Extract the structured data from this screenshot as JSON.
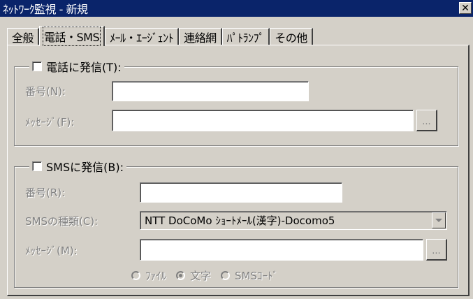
{
  "window": {
    "title": "ﾈｯﾄﾜｰｸ監視 - 新規",
    "close_glyph": "✕"
  },
  "tabs": [
    {
      "label": "全般",
      "active": false
    },
    {
      "label": "電話・SMS",
      "active": true
    },
    {
      "label": "ﾒｰﾙ・ｴｰｼﾞｪﾝﾄ",
      "active": false
    },
    {
      "label": "連絡網",
      "active": false
    },
    {
      "label": "ﾊﾟﾄﾗﾝﾌﾟ",
      "active": false
    },
    {
      "label": "その他",
      "active": false
    }
  ],
  "phone_group": {
    "checkbox_label": "電話に発信(T):",
    "checked": false,
    "number_label": "番号(N):",
    "number_value": "",
    "message_label": "ﾒｯｾｰｼﾞ(F):",
    "message_value": "",
    "browse_label": "..."
  },
  "sms_group": {
    "checkbox_label": "SMSに発信(B):",
    "checked": false,
    "number_label": "番号(R):",
    "number_value": "",
    "type_label": "SMSの種類(C):",
    "type_value": "NTT DoCoMo ｼｮｰﾄﾒｰﾙ(漢字)-Docomo5",
    "message_label": "ﾒｯｾｰｼﾞ(M):",
    "message_value": "",
    "browse_label": "...",
    "format_options": [
      {
        "label": "ﾌｧｲﾙ",
        "selected": false
      },
      {
        "label": "文字",
        "selected": true
      },
      {
        "label": "SMSｺｰﾄﾞ",
        "selected": false
      }
    ]
  }
}
